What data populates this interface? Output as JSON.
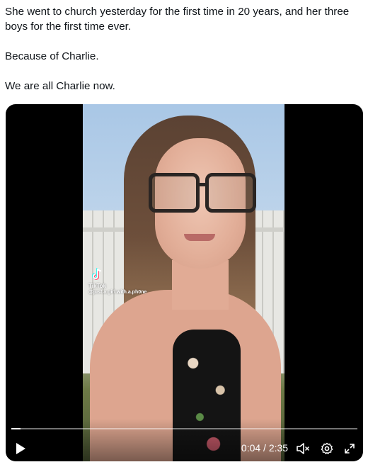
{
  "tweet": {
    "line1": "She went to church yesterday for the first time in 20 years, and her three boys for the first time ever.",
    "line2": "Because of Charlie.",
    "line3": "We are all Charlie now."
  },
  "video": {
    "watermark_brand": "TikTok",
    "watermark_handle": "@just.a.girl.with.a.ph0ne",
    "time_display": "0:04 / 2:35",
    "progress_fraction": 0.026,
    "play_icon": "play-icon",
    "mute_icon": "volume-muted-icon",
    "settings_icon": "gear-icon",
    "fullscreen_icon": "expand-icon"
  }
}
